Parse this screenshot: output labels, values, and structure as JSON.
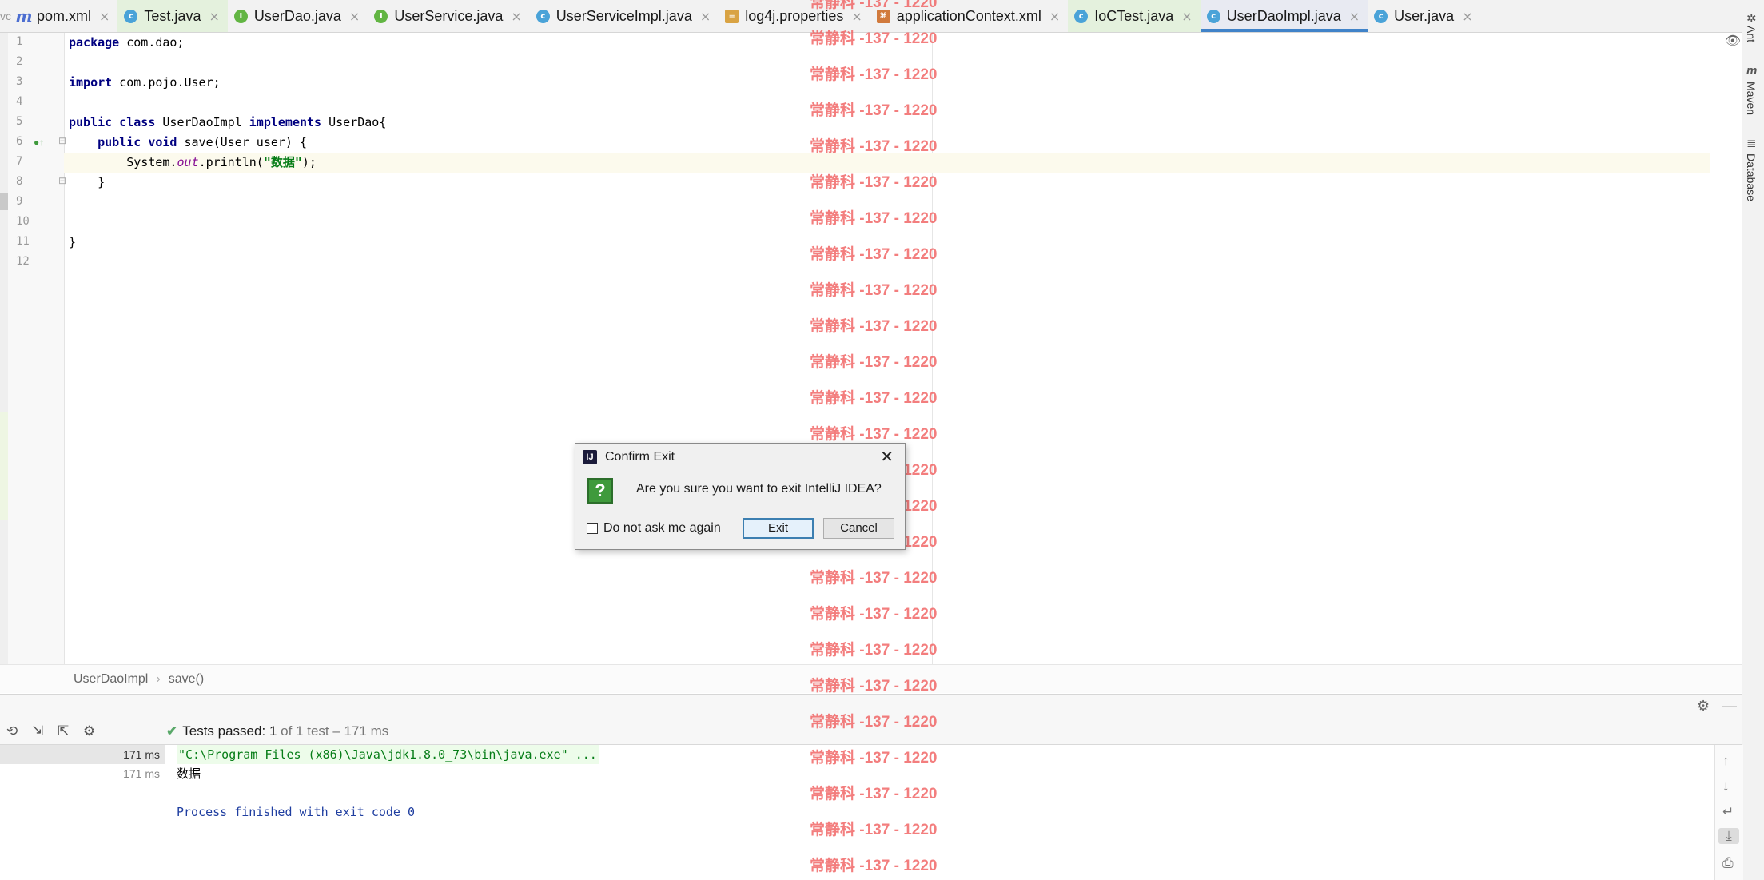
{
  "tabs": [
    {
      "name": "pom.xml",
      "icon": "maven-icon",
      "active": false
    },
    {
      "name": "Test.java",
      "icon": "class-icon",
      "active": false,
      "highlight": true
    },
    {
      "name": "UserDao.java",
      "icon": "interface-icon",
      "active": false
    },
    {
      "name": "UserService.java",
      "icon": "interface-icon",
      "active": false
    },
    {
      "name": "UserServiceImpl.java",
      "icon": "class-icon",
      "active": false
    },
    {
      "name": "log4j.properties",
      "icon": "properties-file-icon",
      "active": false
    },
    {
      "name": "applicationContext.xml",
      "icon": "xml-file-icon",
      "active": false
    },
    {
      "name": "IoCTest.java",
      "icon": "class-icon",
      "active": false,
      "highlight": true
    },
    {
      "name": "UserDaoImpl.java",
      "icon": "class-icon",
      "active": true
    },
    {
      "name": "User.java",
      "icon": "class-icon",
      "active": false
    }
  ],
  "tab_close_glyph": "×",
  "tab_bar_edge": "vc",
  "right_tools": [
    "Ant",
    "Maven",
    "Database"
  ],
  "editor": {
    "line_numbers": [
      "1",
      "2",
      "3",
      "4",
      "5",
      "6",
      "7",
      "8",
      "9",
      "10",
      "11",
      "12"
    ],
    "lines": [
      {
        "segments": [
          {
            "t": "package",
            "c": "kw"
          },
          {
            "t": " com.dao;",
            "c": ""
          }
        ]
      },
      {
        "segments": []
      },
      {
        "segments": [
          {
            "t": "import",
            "c": "kw"
          },
          {
            "t": " com.pojo.User;",
            "c": ""
          }
        ]
      },
      {
        "segments": []
      },
      {
        "segments": [
          {
            "t": "public class",
            "c": "kw"
          },
          {
            "t": " UserDaoImpl ",
            "c": ""
          },
          {
            "t": "implements",
            "c": "kw"
          },
          {
            "t": " UserDao{",
            "c": ""
          }
        ]
      },
      {
        "segments": [
          {
            "t": "    ",
            "c": ""
          },
          {
            "t": "public void",
            "c": "kw"
          },
          {
            "t": " save(User user) {",
            "c": ""
          }
        ]
      },
      {
        "segments": [
          {
            "t": "        System.",
            "c": ""
          },
          {
            "t": "out",
            "c": "fld"
          },
          {
            "t": ".println(",
            "c": ""
          },
          {
            "t": "\"数据\"",
            "c": "str"
          },
          {
            "t": ");",
            "c": ""
          }
        ]
      },
      {
        "segments": [
          {
            "t": "    }",
            "c": ""
          }
        ]
      },
      {
        "segments": []
      },
      {
        "segments": []
      },
      {
        "segments": [
          {
            "t": "}",
            "c": ""
          }
        ]
      },
      {
        "segments": []
      }
    ],
    "current_line": 7
  },
  "breadcrumb": {
    "items": [
      "UserDaoImpl",
      "save()"
    ],
    "separator": "›"
  },
  "run_panel": {
    "tests_status_label": "Tests passed:",
    "tests_passed_count": "1",
    "tests_rest": "of 1 test – 171 ms",
    "time_rows": [
      "171 ms",
      "171 ms"
    ],
    "console_lines": [
      {
        "text": "\"C:\\Program Files (x86)\\Java\\jdk1.8.0_73\\bin\\java.exe\" ...",
        "color": "#067d17",
        "bg": "#edfcea"
      },
      {
        "text": "数据",
        "color": "#000000",
        "bg": ""
      },
      {
        "text": "",
        "color": "#000000",
        "bg": ""
      },
      {
        "text": "Process finished with exit code 0",
        "color": "#1f3ea0",
        "bg": ""
      }
    ]
  },
  "dialog": {
    "title": "Confirm Exit",
    "message": "Are you sure you want to exit IntelliJ IDEA?",
    "checkbox_label": "Do not ask me again",
    "checkbox_checked": false,
    "exit_label": "Exit",
    "cancel_label": "Cancel",
    "question_glyph": "?",
    "close_glyph": "✕"
  },
  "watermark_text": "常静科 -137 - 1220",
  "colors": {
    "accent": "#4083c9",
    "watermark": "#f05a5a",
    "test_pass": "#59a869"
  }
}
